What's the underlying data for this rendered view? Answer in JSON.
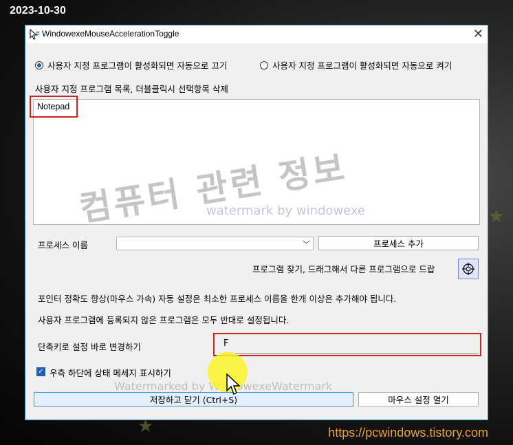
{
  "overlay": {
    "date": "2023-10-30",
    "url": "https://pcwindows.tistory.com",
    "watermark_main": "컴퓨터 관련 정보",
    "watermark_sub": "watermark by windowexe",
    "watermark_bottom": "Watermarked by WindowexeWatermark"
  },
  "window": {
    "title": "WindowexeMouseAccelerationToggle",
    "close_glyph": "✕"
  },
  "options": {
    "radio_off_label": "사용자 지정 프로그램이 활성화되면 자동으로 끄기",
    "radio_on_label": "사용자 지정 프로그램이 활성화되면 자동으로 켜기",
    "selected": "off"
  },
  "list": {
    "label": "사용자 지정 프로그램 목록, 더블클릭시 선택항목 삭제",
    "items": [
      "Notepad"
    ]
  },
  "process": {
    "label": "프로세스 이름",
    "combo_value": "",
    "add_button": "프로세스 추가",
    "drag_hint": "프로그램 찾기, 드래그해서 다른 프로그램으로 드랍"
  },
  "info": {
    "line1": "포인터 정확도 향상(마우스 가속) 자동 설정은 최소한 프로세스 이름을 한개 이상은 추가해야 됩니다.",
    "line2": "사용자 프로그램에 등록되지 않은 프로그램은 모두 반대로 설정됩니다."
  },
  "hotkey": {
    "label": "단축키로 설정 바로 변경하기",
    "value": "F"
  },
  "status": {
    "checkbox_label": "우측 하단에 상태 메세지 표시하기",
    "checked": true
  },
  "buttons": {
    "save_close": "저장하고 닫기 (Ctrl+S)",
    "open_mouse": "마우스 설정 열기"
  },
  "colors": {
    "accent": "#3b8ed8",
    "highlight": "#d02020",
    "url": "#f0a030"
  }
}
